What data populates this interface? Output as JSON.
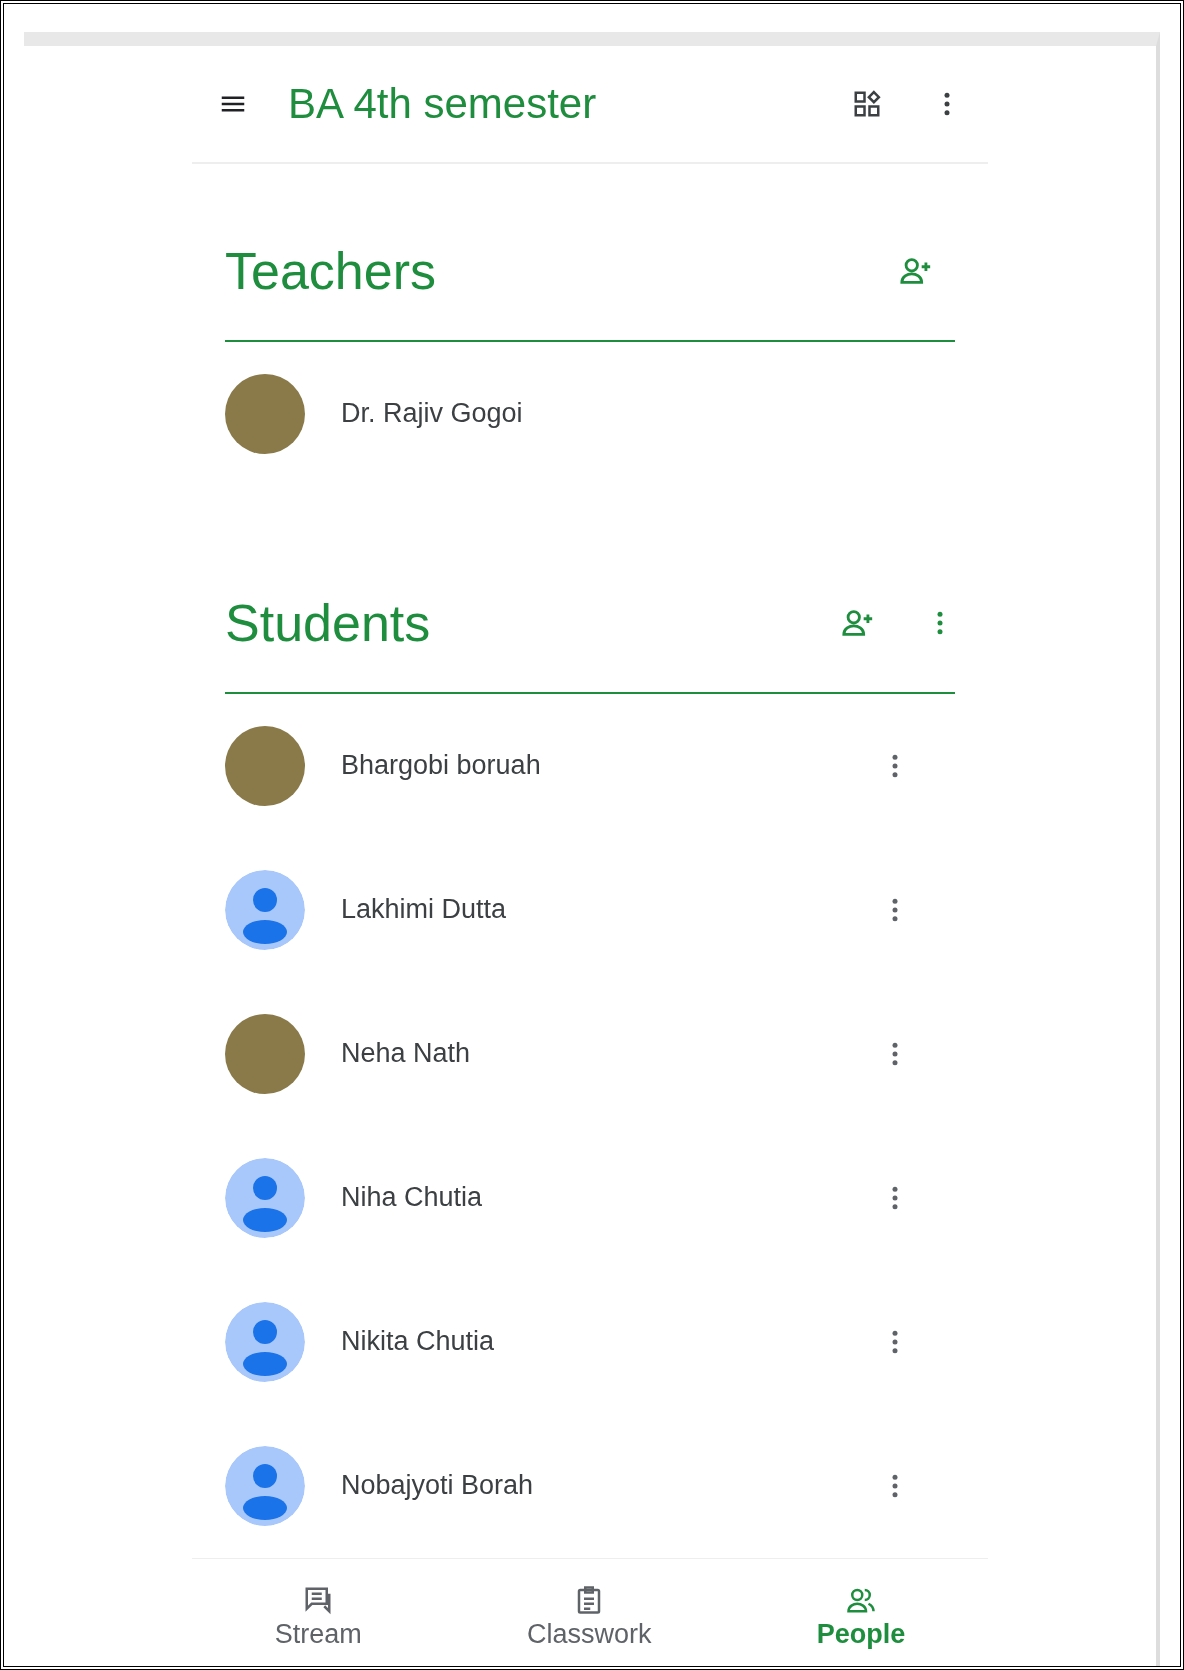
{
  "app_bar": {
    "title": "BA 4th semester"
  },
  "teachers": {
    "heading": "Teachers",
    "people": [
      {
        "name": "Dr. Rajiv Gogoi",
        "kind": "photo"
      }
    ]
  },
  "students": {
    "heading": "Students",
    "people": [
      {
        "name": "Bhargobi boruah",
        "kind": "photo"
      },
      {
        "name": "Lakhimi Dutta",
        "kind": "default"
      },
      {
        "name": "Neha Nath",
        "kind": "photo"
      },
      {
        "name": "Niha Chutia",
        "kind": "default"
      },
      {
        "name": "Nikita Chutia",
        "kind": "default"
      },
      {
        "name": "Nobajyoti Borah",
        "kind": "default"
      }
    ]
  },
  "bottom_nav": [
    {
      "label": "Stream",
      "kind": "stream",
      "selected": false
    },
    {
      "label": "Classwork",
      "kind": "classwork",
      "selected": false
    },
    {
      "label": "People",
      "kind": "people",
      "selected": true
    }
  ]
}
